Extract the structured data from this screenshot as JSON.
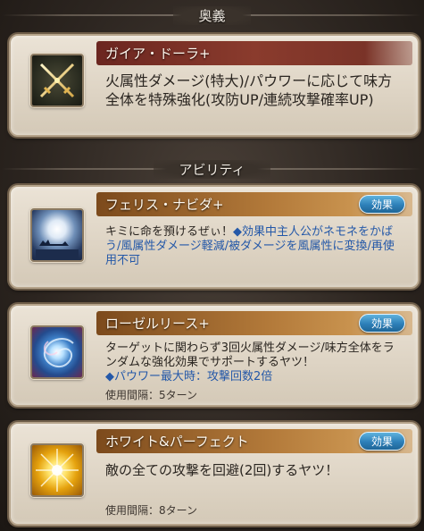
{
  "ougi_section": {
    "title": "奥義"
  },
  "ougi": {
    "name": "ガイア・ドーラ+",
    "desc": "火属性ダメージ(特大)/パウワーに応じて味方全体を特殊強化(攻防UP/連続攻撃確率UP)",
    "icon": "crossed-swords-icon"
  },
  "ability_section": {
    "title": "アビリティ"
  },
  "abilities": [
    {
      "name": "フェリス・ナビダ+",
      "button": "効果",
      "desc_main": "キミに命を預けるぜぃ！",
      "desc_effect": "◆効果中主人公がネモネをかばう/風属性ダメージ軽減/被ダメージを風属性に変換/再使用不可",
      "icon": "moon-sleigh-icon"
    },
    {
      "name": "ローゼルリース+",
      "button": "効果",
      "desc_main": "ターゲットに関わらず3回火属性ダメージ/味方全体をランダムな強化効果でサポートするヤツ！",
      "desc_effect": "◆パウワー最大時：攻撃回数2倍",
      "cooldown": "使用間隔：5ターン",
      "icon": "galaxy-swirl-icon"
    },
    {
      "name": "ホワイト&パーフェクト",
      "button": "効果",
      "desc_main": "敵の全ての攻撃を回避(2回)するヤツ！",
      "cooldown": "使用間隔：8ターン",
      "icon": "golden-burst-icon"
    }
  ]
}
